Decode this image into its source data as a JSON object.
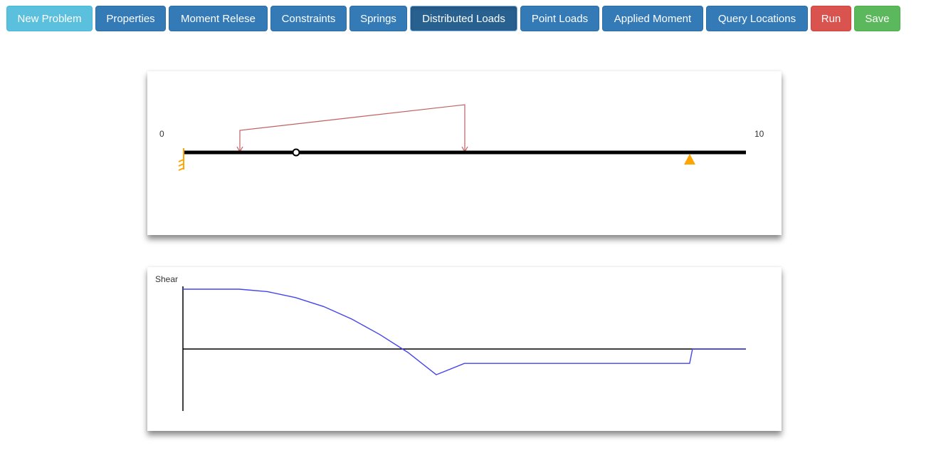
{
  "toolbar": {
    "buttons": [
      {
        "label": "New Problem"
      },
      {
        "label": "Properties"
      },
      {
        "label": "Moment Relese"
      },
      {
        "label": "Constraints"
      },
      {
        "label": "Springs"
      },
      {
        "label": "Distributed Loads"
      },
      {
        "label": "Point Loads"
      },
      {
        "label": "Applied Moment"
      },
      {
        "label": "Query Locations"
      },
      {
        "label": "Run"
      },
      {
        "label": "Save"
      }
    ],
    "active": "Distributed Loads"
  },
  "beam": {
    "start_label": "0",
    "end_label": "10",
    "length": 10,
    "fixed_support_x": 0,
    "moment_release_x": 2,
    "roller_support_x": 9,
    "distributed_load": {
      "x_start": 1,
      "x_end": 5,
      "w_start": 1,
      "w_end": 2.2
    },
    "colors": {
      "beam": "#000000",
      "load": "#c06060",
      "support": "#ffa500",
      "release_fill": "#ffffff"
    }
  },
  "shear": {
    "title": "Shear",
    "colors": {
      "curve": "#4444ee",
      "axis": "#000000"
    }
  },
  "chart_data": {
    "type": "line",
    "title": "Shear",
    "xlabel": "",
    "ylabel": "",
    "xlim": [
      0,
      10
    ],
    "series": [
      {
        "x": [
          0,
          1,
          1.5,
          2,
          2.5,
          3,
          3.5,
          4,
          4.5,
          5,
          9,
          9.05,
          10
        ],
        "y": [
          1,
          1,
          0.96,
          0.86,
          0.71,
          0.5,
          0.24,
          -0.06,
          -0.43,
          -0.24,
          -0.24,
          0,
          0
        ]
      }
    ]
  }
}
